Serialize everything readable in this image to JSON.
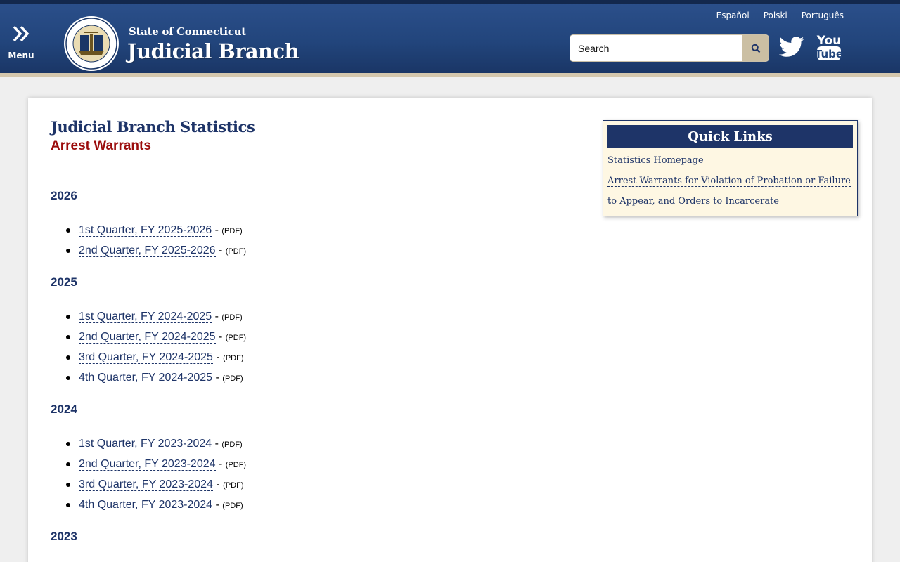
{
  "header": {
    "menu_label": "Menu",
    "state_title": "State of Connecticut",
    "branch_title": "Judicial Branch",
    "languages": [
      "Español",
      "Polski",
      "Português"
    ],
    "search_placeholder": "Search",
    "colors": {
      "header_blue": "#22457c",
      "accent_tan": "#cbbfa3",
      "title_navy": "#1e3468",
      "subtitle_red": "#9b0d0d"
    }
  },
  "main": {
    "title": "Judicial Branch Statistics",
    "subtitle": "Arrest Warrants",
    "years": [
      {
        "year": "2026",
        "quarters": [
          {
            "label": "1st Quarter, FY 2025-2026",
            "type": "(PDF)"
          },
          {
            "label": "2nd Quarter, FY 2025-2026",
            "type": "(PDF)"
          }
        ]
      },
      {
        "year": "2025",
        "quarters": [
          {
            "label": "1st Quarter, FY 2024-2025",
            "type": "(PDF)"
          },
          {
            "label": "2nd Quarter, FY 2024-2025",
            "type": "(PDF)"
          },
          {
            "label": "3rd Quarter, FY 2024-2025",
            "type": "(PDF)"
          },
          {
            "label": "4th Quarter, FY 2024-2025",
            "type": "(PDF)"
          }
        ]
      },
      {
        "year": "2024",
        "quarters": [
          {
            "label": "1st Quarter, FY 2023-2024",
            "type": "(PDF)"
          },
          {
            "label": "2nd Quarter, FY 2023-2024",
            "type": "(PDF)"
          },
          {
            "label": "3rd Quarter, FY 2023-2024",
            "type": "(PDF)"
          },
          {
            "label": "4th Quarter, FY 2023-2024",
            "type": "(PDF)"
          }
        ]
      },
      {
        "year": "2023",
        "quarters": []
      }
    ]
  },
  "quick_links": {
    "title": "Quick Links",
    "links": [
      "Statistics Homepage",
      "Arrest Warrants for Violation of Probation or Failure",
      "to Appear, and Orders to Incarcerate"
    ]
  }
}
